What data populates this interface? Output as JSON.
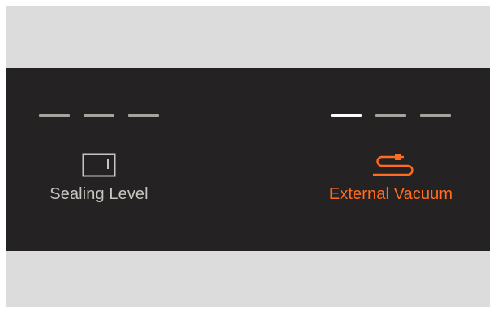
{
  "colors": {
    "frame_bg": "#dcdcdd",
    "panel_bg": "#242223",
    "segment_active": "#ffffff",
    "segment_inactive": "#a7a39d",
    "label_default": "#c8c5c0",
    "label_active": "#ff6b1f"
  },
  "controls": [
    {
      "id": "sealing-level",
      "label": "Sealing Level",
      "icon": "sealing-level-icon",
      "active": false,
      "level": {
        "active_segments": 0,
        "total_segments": 3
      }
    },
    {
      "id": "external-vacuum",
      "label": "External Vacuum",
      "icon": "hose-icon",
      "active": true,
      "level": {
        "active_segments": 1,
        "total_segments": 3
      }
    }
  ]
}
